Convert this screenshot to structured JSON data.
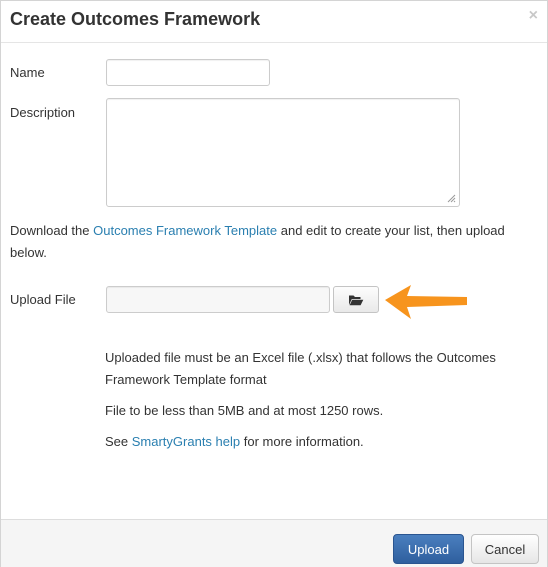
{
  "dialog": {
    "title": "Create Outcomes Framework",
    "close_icon": "×"
  },
  "form": {
    "name_label": "Name",
    "name_value": "",
    "description_label": "Description",
    "description_value": "",
    "download_prefix": "Download the ",
    "download_link": "Outcomes Framework Template",
    "download_suffix": " and edit to create your list, then upload below.",
    "upload_label": "Upload File",
    "upload_value": "",
    "browse_icon": "folder-open-icon"
  },
  "help": {
    "line1": "Uploaded file must be an Excel file (.xlsx) that follows the Outcomes Framework Template format",
    "line2": "File to be less than 5MB and at most 1250 rows.",
    "line3_prefix": "See ",
    "line3_link": "SmartyGrants help",
    "line3_suffix": " for more information."
  },
  "footer": {
    "upload_button": "Upload",
    "cancel_button": "Cancel"
  },
  "colors": {
    "link": "#2a7fb0",
    "primary": "#3a6eae",
    "annotation_arrow": "#f7941d"
  }
}
